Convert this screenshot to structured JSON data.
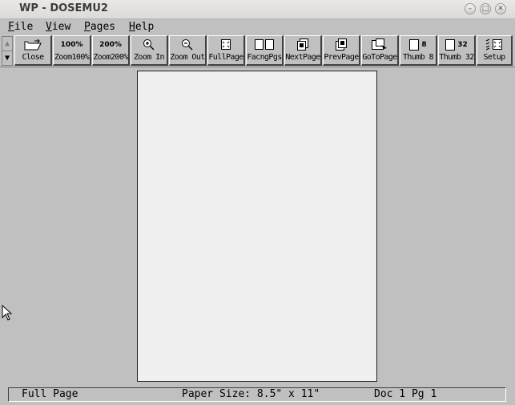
{
  "window": {
    "title": "WP - DOSEMU2",
    "controls": [
      "minimize-icon",
      "maximize-icon",
      "close-icon"
    ]
  },
  "menu": [
    {
      "label": "File",
      "underline": "F",
      "rest": "ile"
    },
    {
      "label": "View",
      "underline": "V",
      "rest": "iew"
    },
    {
      "label": "Pages",
      "underline": "P",
      "rest": "ages"
    },
    {
      "label": "Help",
      "underline": "H",
      "rest": "elp"
    }
  ],
  "toolbar": {
    "buttons": [
      {
        "label": "Close",
        "icon": "folder-close-icon"
      },
      {
        "label": "Zoom100%",
        "icon_text": "100%"
      },
      {
        "label": "Zoom200%",
        "icon_text": "200%"
      },
      {
        "label": "Zoom In",
        "icon": "zoom-in-icon"
      },
      {
        "label": "Zoom Out",
        "icon": "zoom-out-icon"
      },
      {
        "label": "FullPage",
        "icon": "full-page-icon"
      },
      {
        "label": "FacngPgs",
        "icon": "facing-pages-icon"
      },
      {
        "label": "NextPage",
        "icon": "next-page-icon"
      },
      {
        "label": "PrevPage",
        "icon": "prev-page-icon"
      },
      {
        "label": "GoToPage",
        "icon": "goto-page-icon"
      },
      {
        "label": "Thumb 8",
        "icon_text": "8"
      },
      {
        "label": "Thumb 32",
        "icon_text": "32"
      },
      {
        "label": "Setup",
        "icon": "setup-icon"
      }
    ]
  },
  "status": {
    "mode": "Full Page",
    "paper_size": "Paper Size: 8.5\" x 11\"",
    "position": "Doc 1 Pg 1"
  }
}
